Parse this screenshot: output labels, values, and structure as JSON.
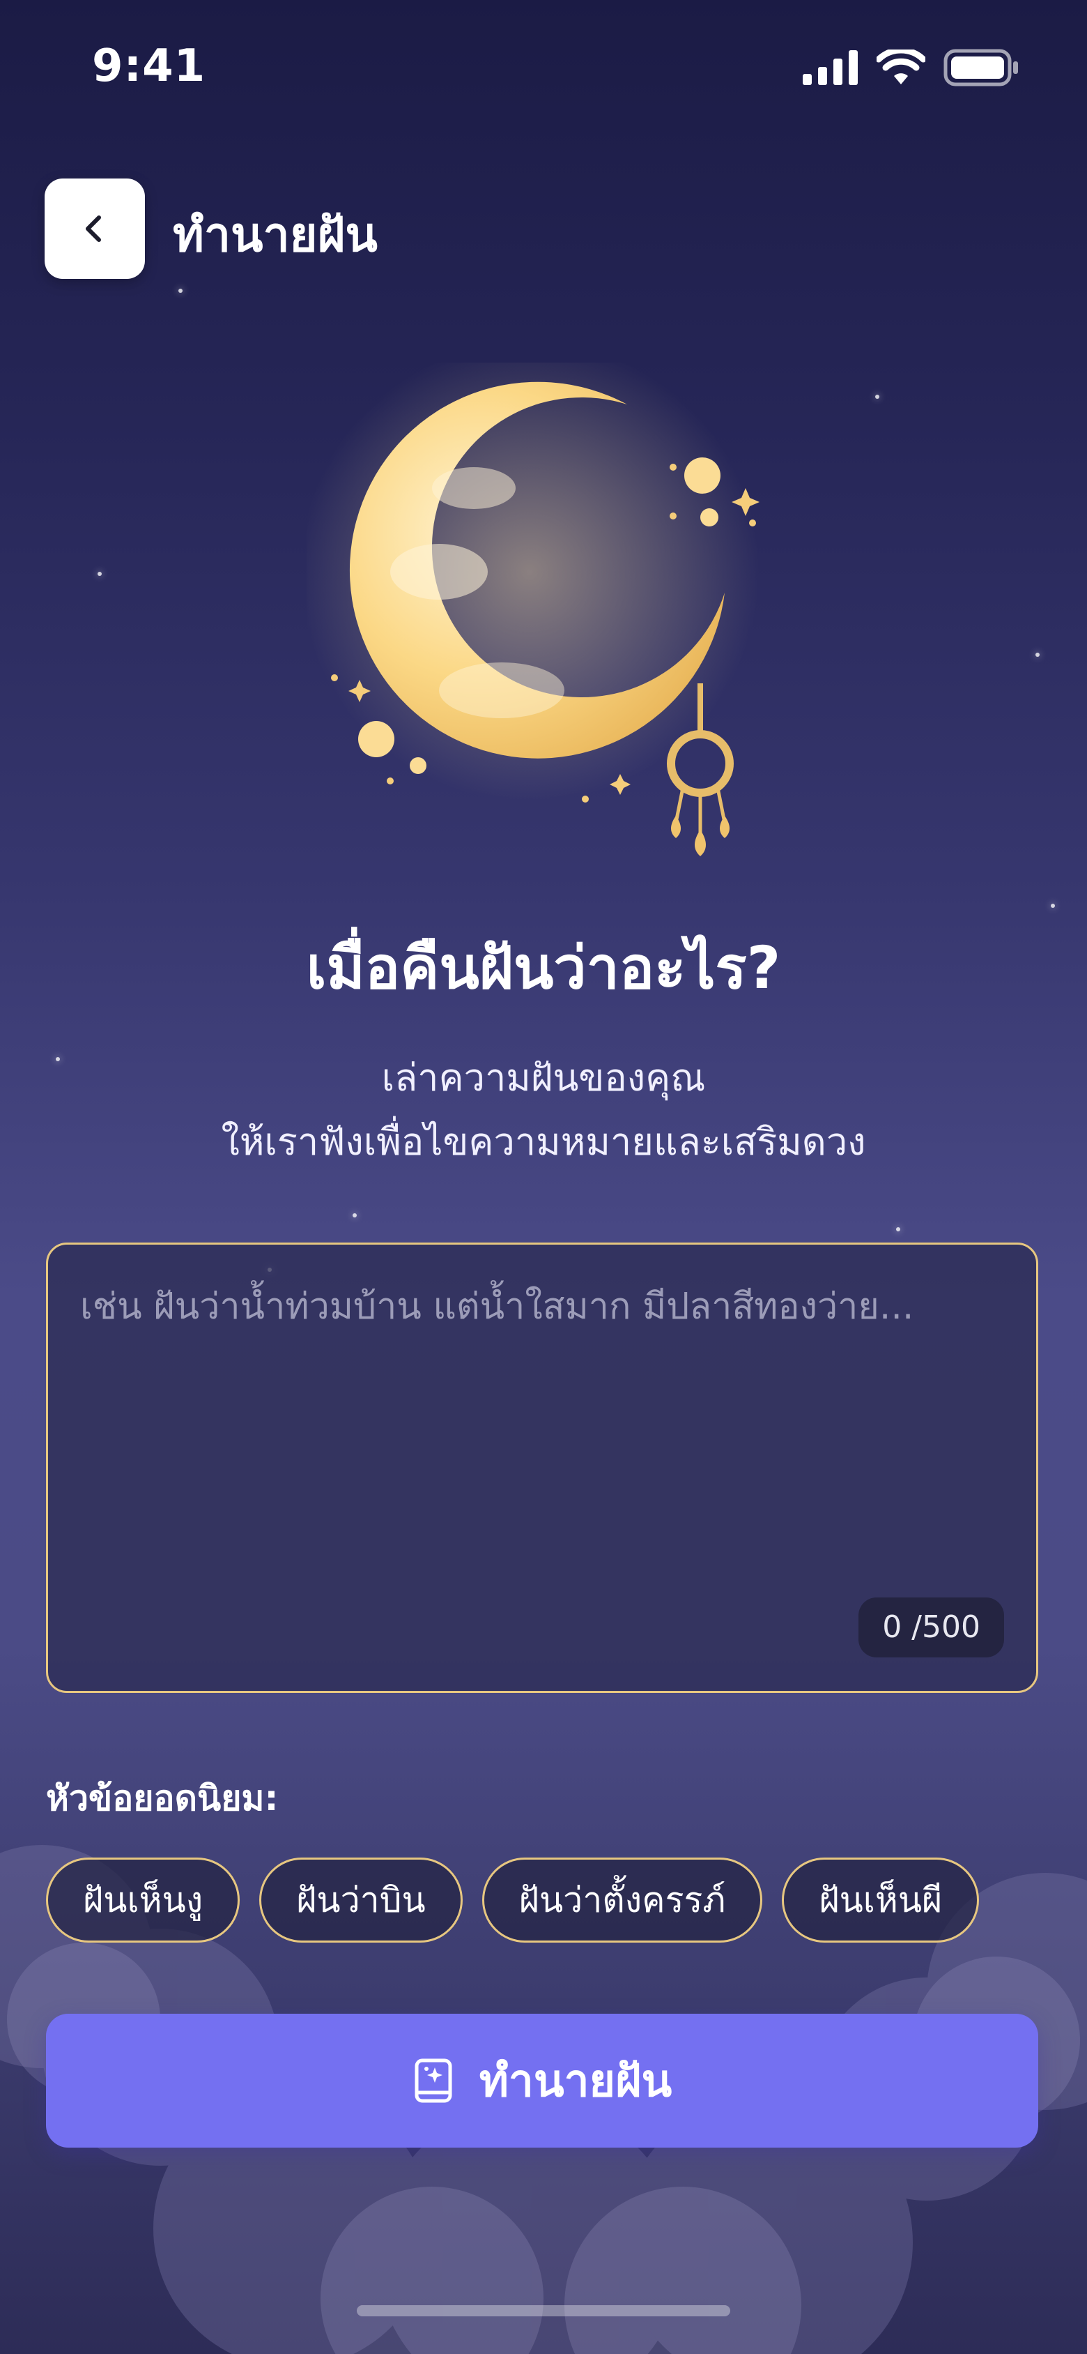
{
  "status_bar": {
    "time": "9:41"
  },
  "nav": {
    "title": "ทำนายฝัน"
  },
  "hero": {
    "headline": "เมื่อคืนฝันว่าอะไร?",
    "subtitle_line1": "เล่าความฝันของคุณ",
    "subtitle_line2": "ให้เราฟังเพื่อไขความหมายและเสริมดวง"
  },
  "dream_input": {
    "placeholder": "เช่น ฝันว่าน้ำท่วมบ้าน แต่น้ำใสมาก มีปลาสีทองว่าย...",
    "value": "",
    "counter": "0 /500"
  },
  "popular": {
    "label": "หัวข้อยอดนิยม:",
    "topics": [
      "ฝันเห็นงู",
      "ฝันว่าบิน",
      "ฝันว่าตั้งครรภ์",
      "ฝันเห็นผี"
    ]
  },
  "cta": {
    "label": "ทำนายฝัน",
    "icon": "sparkle-book-icon"
  },
  "colors": {
    "accent": "#7470f1",
    "gold": "#e7c780",
    "background": "#37376f"
  }
}
